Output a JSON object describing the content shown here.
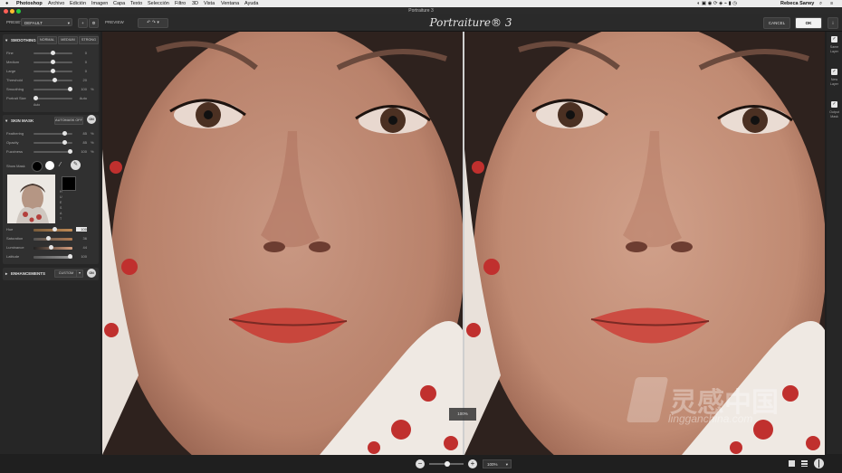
{
  "menubar": {
    "items": [
      "Photoshop",
      "Archivo",
      "Edición",
      "Imagen",
      "Capa",
      "Texto",
      "Selección",
      "Filtro",
      "3D",
      "Vista",
      "Ventana",
      "Ayuda"
    ],
    "user": "Rebeca Sarwy"
  },
  "window": {
    "title": "Portraiture 3"
  },
  "toolbar": {
    "preset_label": "PRESET",
    "preset_value": "DEFAULT",
    "add_symbol": "+",
    "preview_label": "PREVIEW",
    "brand": "Portraiture® 3",
    "cancel_label": "CANCEL",
    "ok_label": "OK",
    "info_symbol": "i"
  },
  "smoothing": {
    "title": "SMOOTHING",
    "modes": [
      "NORMAL",
      "MEDIUM",
      "STRONG"
    ],
    "sliders": [
      {
        "label": "Fine",
        "value": "0",
        "pos": 0.5
      },
      {
        "label": "Medium",
        "value": "0",
        "pos": 0.5
      },
      {
        "label": "Large",
        "value": "0",
        "pos": 0.5
      },
      {
        "label": "Threshold",
        "value": "20",
        "pos": 0.55
      },
      {
        "label": "Smoothing",
        "value": "100",
        "pos": 1.0
      },
      {
        "label": "Portrait Size",
        "value": "Auto",
        "pos": 0.0
      }
    ],
    "size_caption": "Auto",
    "unit": "%"
  },
  "skin_mask": {
    "title": "SKIN MASK",
    "auto_label": "AUTOMASK OFF",
    "toggle": "ON",
    "sliders": [
      {
        "label": "Feathering",
        "value": "85",
        "pos": 0.85
      },
      {
        "label": "Opacity",
        "value": "85",
        "pos": 0.85
      },
      {
        "label": "Fuzziness",
        "value": "100",
        "pos": 1.0
      }
    ],
    "show_mask_label": "Show Mask",
    "vertical_letters": [
      "H",
      "U",
      "E",
      "S",
      "A",
      "T"
    ],
    "hsl": [
      {
        "label": "Hue",
        "value": "100",
        "pos": 0.55
      },
      {
        "label": "Saturation",
        "value": "36",
        "pos": 0.36
      },
      {
        "label": "Luminance",
        "value": "44",
        "pos": 0.44
      },
      {
        "label": "Latitude",
        "value": "100",
        "pos": 1.0
      }
    ]
  },
  "enhancements": {
    "title": "ENHANCEMENTS",
    "preset": "CUSTOM",
    "toggle": "ON"
  },
  "right_strip": {
    "items": [
      {
        "label1": "Same",
        "label2": "Layer"
      },
      {
        "label1": "New",
        "label2": "Layer"
      },
      {
        "label1": "Output",
        "label2": "Mask"
      }
    ]
  },
  "preview": {
    "zoom_overlay": "100%"
  },
  "bottom": {
    "zoom_minus": "−",
    "zoom_plus": "+",
    "zoom_value": "100%"
  },
  "watermark": {
    "cn": "灵感中国",
    "url": "lingganchina.com"
  },
  "colors": {
    "panel": "#262626",
    "accent_white": "#f2f2f2",
    "skin": "#c08a72",
    "lip": "#c8534a"
  }
}
